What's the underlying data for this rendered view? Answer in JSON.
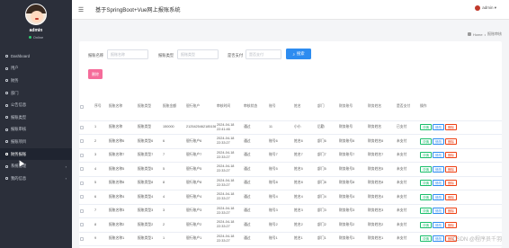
{
  "header": {
    "title": "基于SpringBoot+Vue网上报账系统",
    "admin_label": "admin ▾"
  },
  "sidebar": {
    "username": "admin",
    "status": "Online",
    "items": [
      {
        "label": "Dashboard"
      },
      {
        "label": "用户"
      },
      {
        "label": "财务"
      },
      {
        "label": "部门"
      },
      {
        "label": "公告信息"
      },
      {
        "label": "报账类型"
      },
      {
        "label": "报账审核"
      },
      {
        "label": "报账项目"
      },
      {
        "label": "财务报账"
      },
      {
        "label": "系统管理"
      },
      {
        "label": "我的信息"
      }
    ]
  },
  "breadcrumb": {
    "home": "Home",
    "sep": "•",
    "current": "报账审核"
  },
  "search": {
    "fields": [
      {
        "label": "报账名称",
        "placeholder": "报账名称"
      },
      {
        "label": "报账类型",
        "placeholder": "报账类型"
      },
      {
        "label": "是否支付",
        "placeholder": "是否支付"
      }
    ],
    "search_label": "搜索",
    "delete_label": "删除"
  },
  "table": {
    "headers": [
      "",
      "序号",
      "报账名称",
      "报账类型",
      "报账金额",
      "银行账户",
      "审核时间",
      "审核状态",
      "账号",
      "姓名",
      "部门",
      "财务账号",
      "财务姓名",
      "是否支付",
      "操作"
    ],
    "actions": {
      "detail": "详情",
      "edit": "修改",
      "delete": "删除"
    },
    "rows": [
      {
        "n": "1",
        "name": "报账名称",
        "type": "报账类型",
        "amount": "150000",
        "bank": "21254254621851566",
        "time": "2024-04-18 22:41:46",
        "status": "通过",
        "account": "11",
        "person": "小小",
        "dept": "后勤",
        "facct": "财务账号",
        "fname": "财务姓名",
        "paid": "已支付"
      },
      {
        "n": "2",
        "name": "报账名称6",
        "type": "报账类型6",
        "amount": "6",
        "bank": "银行账户6",
        "time": "2024-04-18 22:33:27",
        "status": "通过",
        "account": "账号6",
        "person": "姓名6",
        "dept": "部门6",
        "facct": "财务账号6",
        "fname": "财务姓名6",
        "paid": "未支付"
      },
      {
        "n": "3",
        "name": "报账名称7",
        "type": "报账类型7",
        "amount": "7",
        "bank": "银行账户7",
        "time": "2024-04-18 22:33:27",
        "status": "通过",
        "account": "账号7",
        "person": "姓名7",
        "dept": "部门7",
        "facct": "财务账号7",
        "fname": "财务姓名7",
        "paid": "未支付"
      },
      {
        "n": "4",
        "name": "报账名称5",
        "type": "报账类型5",
        "amount": "5",
        "bank": "银行账户5",
        "time": "2024-04-18 22:33:27",
        "status": "通过",
        "account": "账号5",
        "person": "姓名5",
        "dept": "部门5",
        "facct": "财务账号5",
        "fname": "财务姓名5",
        "paid": "未支付"
      },
      {
        "n": "5",
        "name": "报账名称8",
        "type": "报账类型8",
        "amount": "8",
        "bank": "银行账户8",
        "time": "2024-04-18 22:33:27",
        "status": "通过",
        "account": "账号8",
        "person": "姓名8",
        "dept": "部门8",
        "facct": "财务账号8",
        "fname": "财务姓名8",
        "paid": "未支付"
      },
      {
        "n": "6",
        "name": "报账名称4",
        "type": "报账类型4",
        "amount": "4",
        "bank": "银行账户4",
        "time": "2024-04-18 22:33:27",
        "status": "通过",
        "account": "账号4",
        "person": "姓名4",
        "dept": "部门4",
        "facct": "财务账号4",
        "fname": "财务姓名4",
        "paid": "未支付"
      },
      {
        "n": "7",
        "name": "报账名称3",
        "type": "报账类型3",
        "amount": "3",
        "bank": "银行账户3",
        "time": "2024-04-18 22:33:27",
        "status": "通过",
        "account": "账号3",
        "person": "姓名3",
        "dept": "部门3",
        "facct": "财务账号3",
        "fname": "财务姓名3",
        "paid": "未支付"
      },
      {
        "n": "8",
        "name": "报账名称2",
        "type": "报账类型2",
        "amount": "2",
        "bank": "银行账户2",
        "time": "2024-04-18 22:33:27",
        "status": "通过",
        "account": "账号2",
        "person": "姓名2",
        "dept": "部门2",
        "facct": "财务账号2",
        "fname": "财务姓名2",
        "paid": "未支付"
      },
      {
        "n": "9",
        "name": "报账名称1",
        "type": "报账类型1",
        "amount": "1",
        "bank": "银行账户1",
        "time": "2024-04-18 22:33:27",
        "status": "通过",
        "account": "账号1",
        "person": "姓名1",
        "dept": "部门1",
        "facct": "财务账号1",
        "fname": "财务姓名1",
        "paid": "未支付"
      }
    ]
  },
  "watermark": "CSDN @程序员千羽"
}
